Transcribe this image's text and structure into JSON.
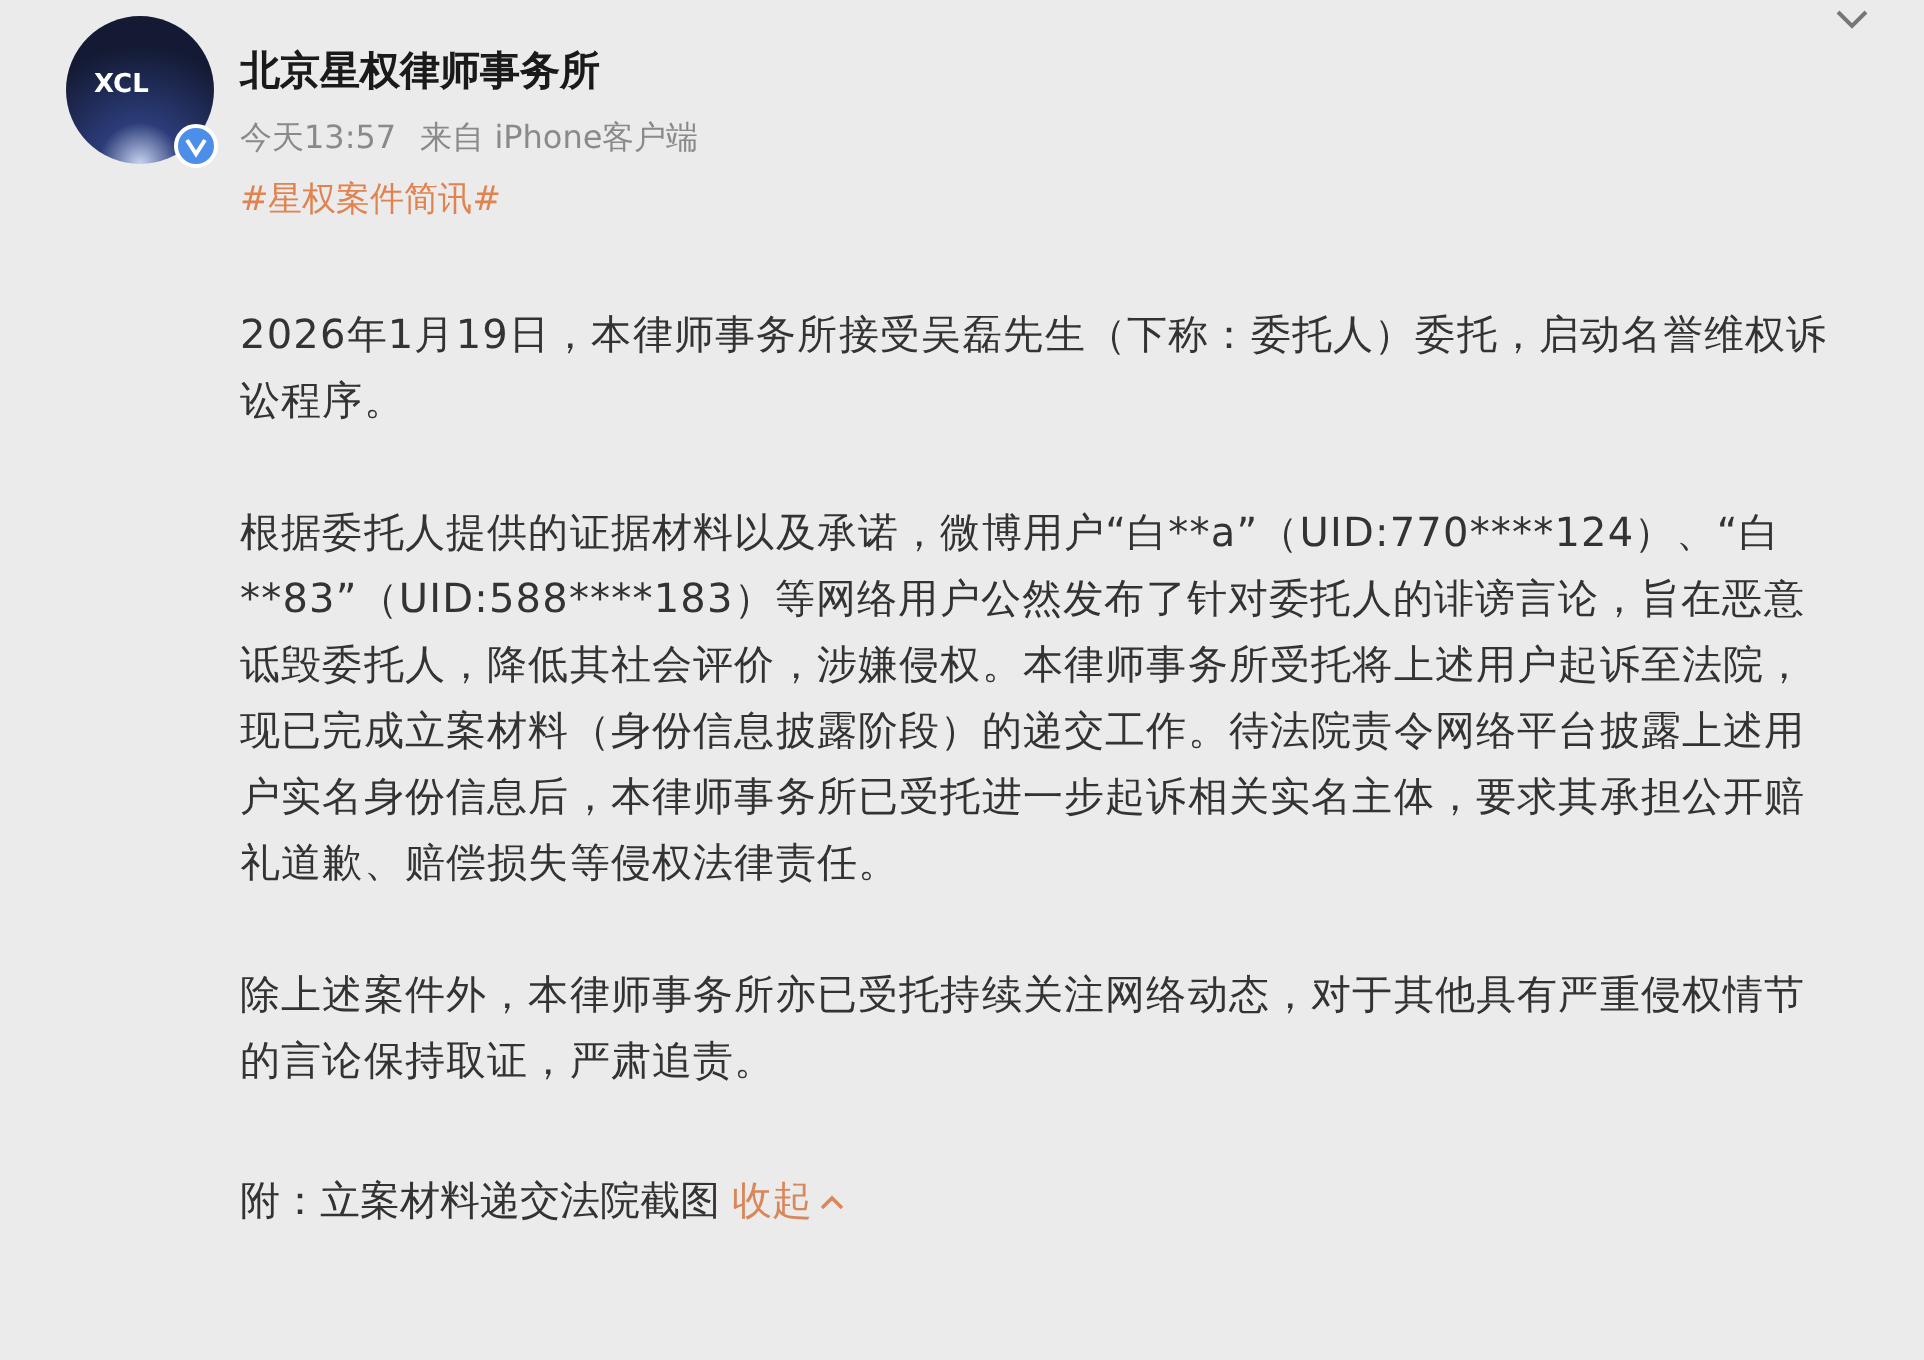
{
  "post": {
    "avatar_text": "XCL",
    "verified": true,
    "author": "北京星权律师事务所",
    "time": "今天13:57",
    "source": "来自 iPhone客户端",
    "hashtag": "#星权案件简讯#",
    "paragraphs": [
      "2026年1月19日，本律师事务所接受吴磊先生（下称：委托人）委托，启动名誉维权诉讼程序。",
      "根据委托人提供的证据材料以及承诺，微博用户“白**a”（UID:770****124）、“白**83”（UID:588****183）等网络用户公然发布了针对委托人的诽谤言论，旨在恶意诋毁委托人，降低其社会评价，涉嫌侵权。本律师事务所受托将上述用户起诉至法院，现已完成立案材料（身份信息披露阶段）的递交工作。待法院责令网络平台披露上述用户实名身份信息后，本律师事务所已受托进一步起诉相关实名主体，要求其承担公开赔礼道歉、赔偿损失等侵权法律责任。",
      "除上述案件外，本律师事务所亦已受托持续关注网络动态，对于其他具有严重侵权情节的言论保持取证，严肃追责。"
    ],
    "attachment": "附：立案材料递交法院截图",
    "collapse": "收起"
  }
}
